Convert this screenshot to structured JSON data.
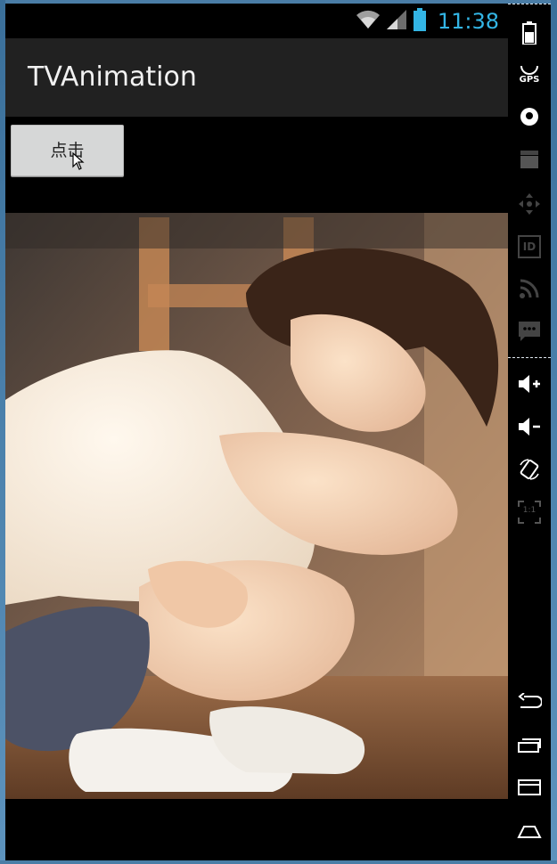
{
  "status_bar": {
    "time": "11:38",
    "icons": [
      "wifi-icon",
      "signal-icon",
      "battery-icon"
    ]
  },
  "action_bar": {
    "title": "TVAnimation"
  },
  "button": {
    "label": "点击"
  },
  "image": {
    "semantic": "photo of a young woman crouching in a white t-shirt and sneakers"
  },
  "emulator_controls": {
    "icons": [
      "battery-icon",
      "gps-icon",
      "camera-icon",
      "video-icon",
      "dpad-icon",
      "id-icon",
      "rss-icon",
      "sms-icon",
      "volume-up-icon",
      "volume-down-icon",
      "rotate-icon",
      "fullscreen-icon",
      "back-icon",
      "recent-apps-icon",
      "menu-icon",
      "home-icon"
    ],
    "gps_label": "GPS",
    "id_label": "ID",
    "scale_label": "1:1"
  },
  "colors": {
    "accent": "#33b5e5",
    "action_bar": "#212121",
    "button": "#d6d7d7",
    "frame": "#4a7da6"
  }
}
